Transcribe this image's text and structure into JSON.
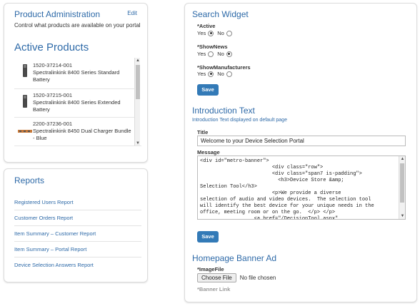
{
  "product_admin": {
    "title": "Product Administration",
    "edit_label": "Edit",
    "description": "Control what products are available on your portal",
    "active_title": "Active Products",
    "items": [
      {
        "sku": "1520-37214-001",
        "name": "Spectralinkink 8400 Series Standard Battery"
      },
      {
        "sku": "1520-37215-001",
        "name": "Spectralinkink 8400 Series Extended Battery"
      },
      {
        "sku": "2200-37236-001",
        "name": "Spectralinkink 8450 Dual Charger Bundle - Blue"
      }
    ]
  },
  "reports": {
    "title": "Reports",
    "links": [
      "Registered Users Report",
      "Customer Orders Report",
      "Item Summary – Customer Report",
      "Item Summary – Portal Report",
      "Device Selection Answers Report"
    ]
  },
  "search_widget": {
    "title": "Search Widget",
    "fields": [
      {
        "label": "*Active",
        "yes": "Yes",
        "no": "No",
        "selected": "yes"
      },
      {
        "label": "*ShowNews",
        "yes": "Yes",
        "no": "No",
        "selected": "no"
      },
      {
        "label": "*ShowManufacturers",
        "yes": "Yes",
        "no": "No",
        "selected": "yes"
      }
    ],
    "save_label": "Save"
  },
  "introduction": {
    "title": "Introduction Text",
    "note": "Introduction Text displayed on default page",
    "title_label": "Title",
    "title_value": "Welcome to your Device Selection Portal",
    "message_label": "Message",
    "message_value": "<div id=\"metro-banner\">\n                        <div class=\"row\">\n                        <div class=\"span7 is-padding\">\n                          <h3>Device Store &amp;\nSelection Tool</h3>\n                        <p>We provide a diverse\nselection of audio and video devices.  The selection tool\nwill identify the best device for your unique needs in the\noffice, meeting room or on the go.  </p> </p>\n                  <a href=\"/DecisionTool.aspx\"",
    "save_label": "Save"
  },
  "banner": {
    "title": "Homepage Banner Ad",
    "image_label": "*ImageFile",
    "choose_label": "Choose File",
    "no_file": "No file chosen",
    "link_label": "*Banner Link"
  },
  "colors": {
    "accent": "#2e6aa8",
    "button": "#337ab7"
  }
}
